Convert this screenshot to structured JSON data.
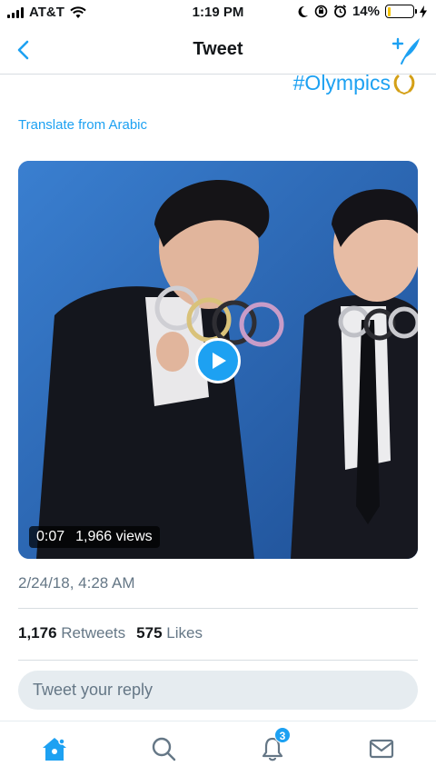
{
  "status_bar": {
    "carrier": "AT&T",
    "time": "1:19 PM",
    "battery": "14%",
    "battery_level": 0.14
  },
  "nav": {
    "title": "Tweet",
    "back_icon": "chevron-left-icon",
    "compose_icon": "compose-tweet-icon"
  },
  "tweet": {
    "hashtag": "#Olympics",
    "translate_link": "Translate from Arabic",
    "video": {
      "duration": "0:07",
      "views": "1,966 views"
    },
    "timestamp": "2/24/18, 4:28 AM",
    "stats": {
      "retweets_count": "1,176",
      "retweets_label": "Retweets",
      "likes_count": "575",
      "likes_label": "Likes"
    }
  },
  "reply": {
    "placeholder": "Tweet your reply"
  },
  "tabbar": {
    "notifications_badge": "3"
  },
  "colors": {
    "accent": "#1da1f2",
    "secondary_text": "#657786",
    "reply_bg": "#e6ecf0",
    "video_bg": "#2a69b8",
    "battery_fill": "#f5c400"
  }
}
